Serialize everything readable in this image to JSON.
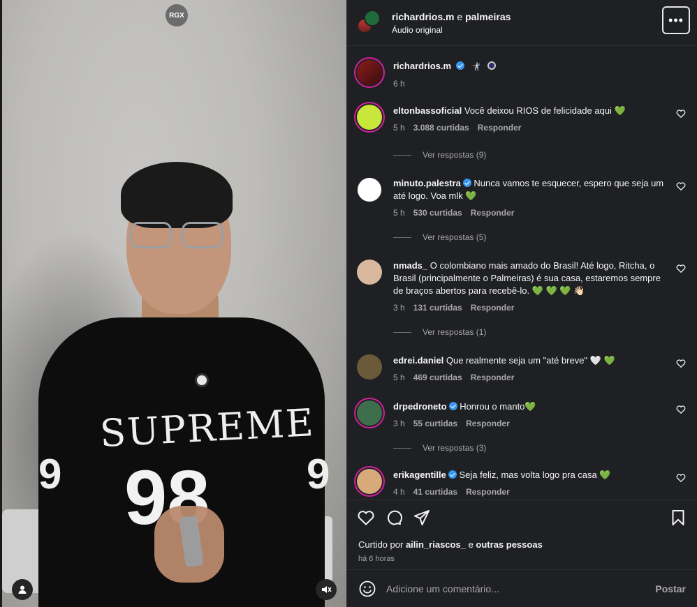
{
  "video": {
    "watermark": "RGX",
    "jersey_text": "SUPREME",
    "jersey_number": "98",
    "sleeve_number": "9"
  },
  "header": {
    "author": "richardrios.m",
    "conjunction": "e",
    "collaborator": "palmeiras",
    "audio": "Áudio original"
  },
  "caption": {
    "user": "richardrios.m",
    "time": "6 h"
  },
  "comments": [
    {
      "user": "eltonbassoficial",
      "verified": false,
      "text": "Você deixou RIOS de felicidade aqui",
      "emoji": "💚",
      "time": "5 h",
      "likes": "3.088 curtidas",
      "reply": "Responder",
      "replies": "Ver respostas (9)"
    },
    {
      "user": "minuto.palestra",
      "verified": true,
      "text": "Nunca vamos te esquecer, espero que seja um até logo. Voa mlk",
      "emoji": "💚",
      "time": "5 h",
      "likes": "530 curtidas",
      "reply": "Responder",
      "replies": "Ver respostas (5)"
    },
    {
      "user": "nmads_",
      "verified": false,
      "text": "O colombiano mais amado do Brasil! Até logo, Ritcha, o Brasil (principalmente o Palmeiras) é sua casa, estaremos sempre de braços abertos para recebê-lo.",
      "emoji": "💚 💚 💚 👋🏻",
      "time": "3 h",
      "likes": "131 curtidas",
      "reply": "Responder",
      "replies": "Ver respostas (1)"
    },
    {
      "user": "edrei.daniel",
      "verified": false,
      "text": "Que realmente seja um \"até breve\"",
      "emoji": "🤍 💚",
      "time": "5 h",
      "likes": "469 curtidas",
      "reply": "Responder",
      "replies": ""
    },
    {
      "user": "drpedroneto",
      "verified": true,
      "text": "Honrou o manto",
      "emoji": "💚",
      "time": "3 h",
      "likes": "55 curtidas",
      "reply": "Responder",
      "replies": "Ver respostas (3)"
    },
    {
      "user": "erikagentille",
      "verified": true,
      "text": "Seja feliz, mas volta logo pra casa",
      "emoji": "💚",
      "time": "4 h",
      "likes": "41 curtidas",
      "reply": "Responder",
      "replies": ""
    }
  ],
  "footer": {
    "liked_prefix": "Curtido por",
    "liked_user": "ailin_riascos_",
    "liked_joiner": "e",
    "liked_others": "outras pessoas",
    "ago": "há 6 horas",
    "placeholder": "Adicione um comentário...",
    "post": "Postar"
  },
  "colors": {
    "panel_bg": "#1f2023",
    "verified": "#3897f0",
    "heart_green": "#1ed760",
    "story_ring": "#d3209b"
  },
  "icons": [
    "more-icon",
    "heart-icon",
    "comment-icon",
    "share-icon",
    "save-icon",
    "emoji-icon",
    "user-icon",
    "mute-icon"
  ]
}
